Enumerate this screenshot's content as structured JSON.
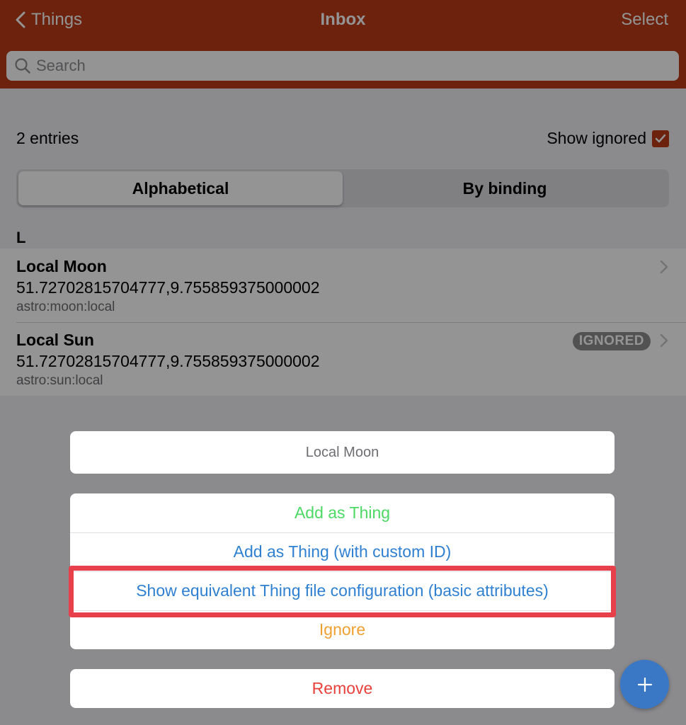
{
  "navbar": {
    "back_label": "Things",
    "title": "Inbox",
    "select_label": "Select",
    "background": "#ba3b18"
  },
  "search": {
    "placeholder": "Search",
    "value": ""
  },
  "summary": {
    "entries_count": "2 entries",
    "show_ignored_label": "Show ignored",
    "show_ignored_checked": true
  },
  "segments": {
    "alphabetical": "Alphabetical",
    "by_binding": "By binding",
    "active": "Alphabetical"
  },
  "list": {
    "section_header": "L",
    "items": [
      {
        "title": "Local Moon",
        "location": "51.72702815704777,9.755859375000002",
        "uid": "astro:moon:local",
        "badge": ""
      },
      {
        "title": "Local Sun",
        "location": "51.72702815704777,9.755859375000002",
        "uid": "astro:sun:local",
        "badge": "IGNORED"
      }
    ]
  },
  "action_sheet": {
    "title": "Local Moon",
    "actions": [
      {
        "label": "Add as Thing",
        "color": "#4cd964"
      },
      {
        "label": "Add as Thing (with custom ID)",
        "color": "#2f80d1"
      },
      {
        "label": "Show equivalent Thing file configuration (basic attributes)",
        "color": "#2f80d1",
        "highlighted": true
      },
      {
        "label": "Ignore",
        "color": "#f0a030"
      }
    ],
    "cancel": {
      "label": "Remove",
      "color": "#e8403a"
    }
  },
  "fab": {
    "icon": "plus-icon",
    "color": "#3a78c6"
  }
}
